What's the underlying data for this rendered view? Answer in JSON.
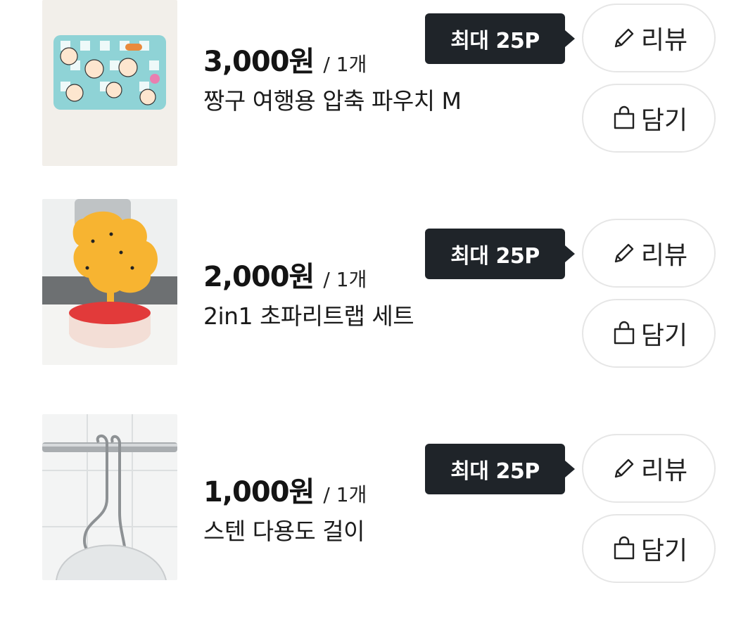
{
  "items": [
    {
      "price": "3,000원",
      "qty": "/ 1개",
      "name": "짱구 여행용 압축 파우치 M",
      "badge": "최대 25P",
      "review_label": "리뷰",
      "cart_label": "담기",
      "image": "pouch-image"
    },
    {
      "price": "2,000원",
      "qty": "/ 1개",
      "name": "2in1 초파리트랩 세트",
      "badge": "최대 25P",
      "review_label": "리뷰",
      "cart_label": "담기",
      "image": "fly-trap-image"
    },
    {
      "price": "1,000원",
      "qty": "/ 1개",
      "name": "스텐 다용도 걸이",
      "badge": "최대 25P",
      "review_label": "리뷰",
      "cart_label": "담기",
      "image": "steel-hook-image"
    }
  ],
  "icons": {
    "review": "pencil-icon",
    "cart": "shopping-bag-icon"
  },
  "colors": {
    "badge_bg": "#1f2429",
    "pill_border": "#e6e6e6",
    "text": "#141414"
  }
}
